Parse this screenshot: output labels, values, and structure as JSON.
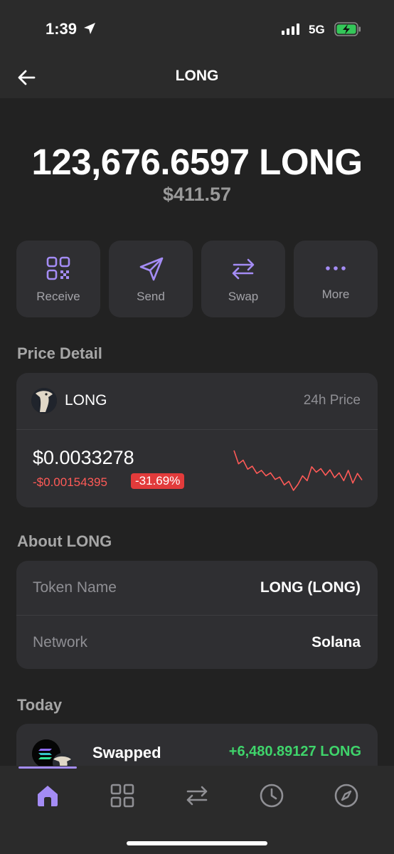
{
  "status_bar": {
    "time": "1:39",
    "network": "5G"
  },
  "header": {
    "title": "LONG",
    "back_icon": "arrow-left-icon"
  },
  "balance": {
    "amount": "123,676.6597 LONG",
    "usd": "$411.57"
  },
  "actions": [
    {
      "label": "Receive",
      "icon": "qr-code-icon"
    },
    {
      "label": "Send",
      "icon": "send-icon"
    },
    {
      "label": "Swap",
      "icon": "swap-icon"
    },
    {
      "label": "More",
      "icon": "more-dots-icon"
    }
  ],
  "price_detail": {
    "section_title": "Price Detail",
    "token_name": "LONG",
    "period_label": "24h Price",
    "price": "$0.0033278",
    "change": "-$0.00154395",
    "change_pct": "-31.69%",
    "sparkline_points": [
      7.2,
      5.0,
      5.6,
      4.1,
      4.6,
      3.4,
      3.9,
      3.0,
      3.5,
      2.4,
      2.8,
      1.5,
      2.1,
      0.6,
      1.6,
      3.0,
      2.2,
      4.5,
      3.6,
      4.2,
      3.1,
      4.0,
      2.7,
      3.5,
      2.2,
      3.9,
      1.8,
      3.4,
      2.3
    ]
  },
  "about": {
    "section_title": "About LONG",
    "rows": [
      {
        "label": "Token Name",
        "value": "LONG (LONG)"
      },
      {
        "label": "Network",
        "value": "Solana"
      }
    ]
  },
  "today": {
    "section_title": "Today",
    "transactions": [
      {
        "title": "Swapped",
        "amount": "+6,480.89127 LONG"
      }
    ]
  },
  "tabbar": {
    "tabs": [
      {
        "icon": "home-icon",
        "active": true
      },
      {
        "icon": "grid-icon",
        "active": false
      },
      {
        "icon": "swap-icon",
        "active": false
      },
      {
        "icon": "clock-icon",
        "active": false
      },
      {
        "icon": "compass-icon",
        "active": false
      }
    ]
  },
  "colors": {
    "accent": "#a48cf5",
    "negative": "#ff5a57",
    "badge_negative": "#e23b3b",
    "positive": "#3fd46b",
    "background": "#222222",
    "card": "#2f2f32"
  }
}
